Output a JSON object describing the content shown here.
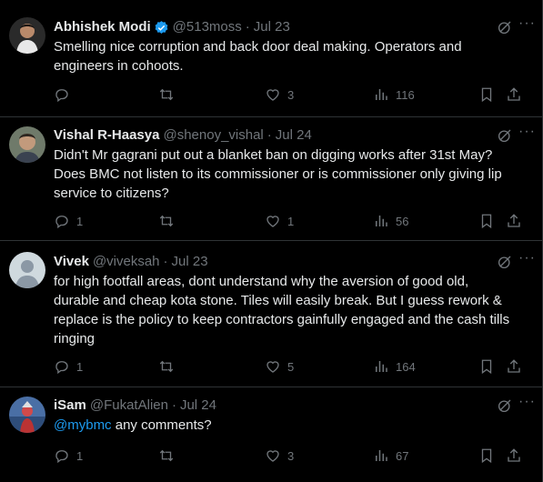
{
  "tweets": [
    {
      "name": "Abhishek Modi",
      "verified": true,
      "handle": "@513moss",
      "dot": "·",
      "date": "Jul 23",
      "text": "Smelling nice corruption and back door deal making. Operators and engineers in cohoots.",
      "replies": "",
      "retweets": "",
      "likes": "3",
      "views": "116"
    },
    {
      "name": "Vishal R-Haasya",
      "verified": false,
      "handle": "@shenoy_vishal",
      "dot": "·",
      "date": "Jul 24",
      "text": "Didn't Mr gagrani put out a blanket ban on digging works after 31st May? Does BMC not listen to its commissioner or is commissioner only giving lip service to citizens?",
      "replies": "1",
      "retweets": "",
      "likes": "1",
      "views": "56"
    },
    {
      "name": "Vivek",
      "verified": false,
      "handle": "@viveksah",
      "dot": "·",
      "date": "Jul 23",
      "text": "for high footfall areas, dont understand why the aversion of good old, durable and cheap kota stone. Tiles will easily break. But I guess rework & replace is the policy to keep contractors gainfully engaged and the cash tills ringing",
      "replies": "1",
      "retweets": "",
      "likes": "5",
      "views": "164"
    },
    {
      "name": "iSam",
      "verified": false,
      "handle": "@FukatAlien",
      "dot": "·",
      "date": "Jul 24",
      "mention": "@mybmc",
      "text": " any comments?",
      "replies": "1",
      "retweets": "",
      "likes": "3",
      "views": "67"
    }
  ],
  "icons": {
    "reply": "reply-icon",
    "retweet": "retweet-icon",
    "like": "heart-icon",
    "views": "views-icon",
    "bookmark": "bookmark-icon",
    "share": "share-icon",
    "grok": "grok-icon",
    "more": "more-icon",
    "verified": "verified-badge-icon"
  },
  "colors": {
    "background": "#000000",
    "text": "#e7e9ea",
    "muted": "#71767b",
    "accent": "#1d9bf0",
    "border": "#2f3336"
  }
}
